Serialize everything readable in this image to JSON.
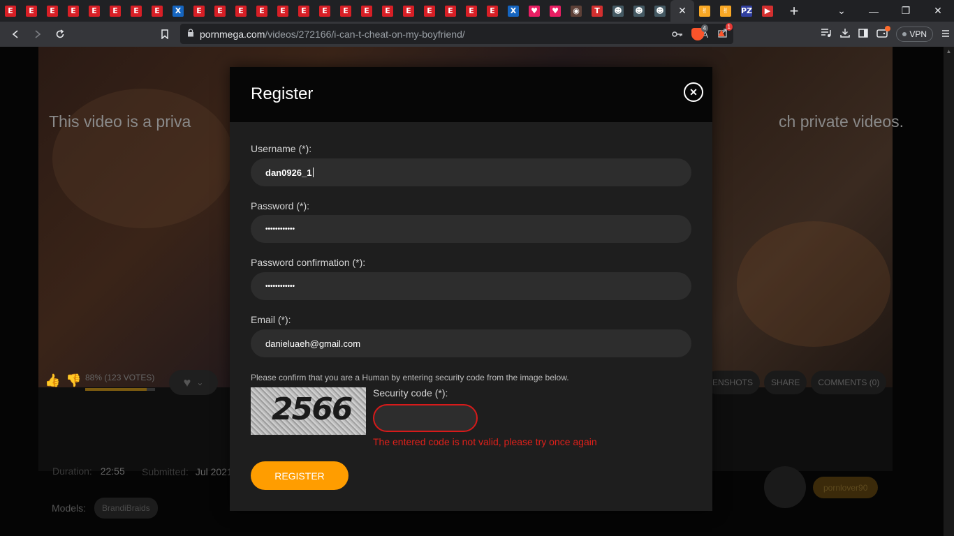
{
  "browser": {
    "tabs": [
      {
        "icon": "E",
        "color": "#d81f26"
      },
      {
        "icon": "E",
        "color": "#d81f26"
      },
      {
        "icon": "E",
        "color": "#d81f26"
      },
      {
        "icon": "E",
        "color": "#d81f26"
      },
      {
        "icon": "E",
        "color": "#d81f26"
      },
      {
        "icon": "E",
        "color": "#d81f26"
      },
      {
        "icon": "E",
        "color": "#d81f26"
      },
      {
        "icon": "E",
        "color": "#d81f26"
      },
      {
        "icon": "X",
        "color": "#1565c0"
      },
      {
        "icon": "E",
        "color": "#d81f26"
      },
      {
        "icon": "E",
        "color": "#d81f26"
      },
      {
        "icon": "E",
        "color": "#d81f26"
      },
      {
        "icon": "E",
        "color": "#d81f26"
      },
      {
        "icon": "E",
        "color": "#d81f26"
      },
      {
        "icon": "E",
        "color": "#d81f26"
      },
      {
        "icon": "E",
        "color": "#d81f26"
      },
      {
        "icon": "E",
        "color": "#d81f26"
      },
      {
        "icon": "E",
        "color": "#d81f26"
      },
      {
        "icon": "E",
        "color": "#d81f26"
      },
      {
        "icon": "E",
        "color": "#d81f26"
      },
      {
        "icon": "E",
        "color": "#d81f26"
      },
      {
        "icon": "E",
        "color": "#d81f26"
      },
      {
        "icon": "E",
        "color": "#d81f26"
      },
      {
        "icon": "E",
        "color": "#d81f26"
      },
      {
        "icon": "X",
        "color": "#1565c0"
      },
      {
        "icon": "♥",
        "color": "#e91e63"
      },
      {
        "icon": "♥",
        "color": "#e91e63"
      },
      {
        "icon": "◉",
        "color": "#5d4037"
      },
      {
        "icon": "T",
        "color": "#d32f2f"
      },
      {
        "icon": "☻",
        "color": "#455a64"
      },
      {
        "icon": "☻",
        "color": "#455a64"
      },
      {
        "icon": "☻",
        "color": "#455a64"
      }
    ],
    "tabs_after_active": [
      {
        "icon": "✌",
        "color": "#f9a825"
      },
      {
        "icon": "✌",
        "color": "#f9a825"
      },
      {
        "icon": "PZ",
        "color": "#303f9f"
      },
      {
        "icon": "▶",
        "color": "#d32f2f"
      }
    ],
    "active_tab_close": "✕",
    "new_tab": "+",
    "window_controls": {
      "collapse": "⌄",
      "minimize": "—",
      "restore": "❐",
      "close": "✕"
    },
    "url_host": "pornmega.com",
    "url_path": "/videos/272166/i-can-t-cheat-on-my-boyfriend/",
    "shield_count": "4",
    "rewards_count": "1",
    "vpn_label": "VPN"
  },
  "page": {
    "private_msg_left": "This video is a priva",
    "private_msg_right": "ch private videos.",
    "rating_text": "88% (123 VOTES)",
    "rating_fraction": 0.88,
    "tab_links": [
      "ENSHOTS",
      "SHARE",
      "COMMENTS (0)"
    ],
    "duration_label": "Duration:",
    "duration_value": "22:55",
    "submitted_label": "Submitted:",
    "submitted_value": "Jul 2021",
    "models_label": "Models:",
    "model_name": "BrandiBraids",
    "uploader": "pornlover90"
  },
  "modal": {
    "title": "Register",
    "close_symbol": "✕",
    "username_label": "Username (*):",
    "username_value": "dan0926_1",
    "password_label": "Password (*):",
    "password_value": "••••••••••••",
    "password_confirm_label": "Password confirmation (*):",
    "password_confirm_value": "••••••••••••",
    "email_label": "Email (*):",
    "email_value": "danieluaeh@gmail.com",
    "captcha_note": "Please confirm that you are a Human by entering security code from the image below.",
    "captcha_digits": "2566",
    "security_label": "Security code (*):",
    "security_error": "The entered code is not valid, please try once again",
    "register_label": "REGISTER",
    "accent": "#ff9d00",
    "error_color": "#e0201a"
  }
}
